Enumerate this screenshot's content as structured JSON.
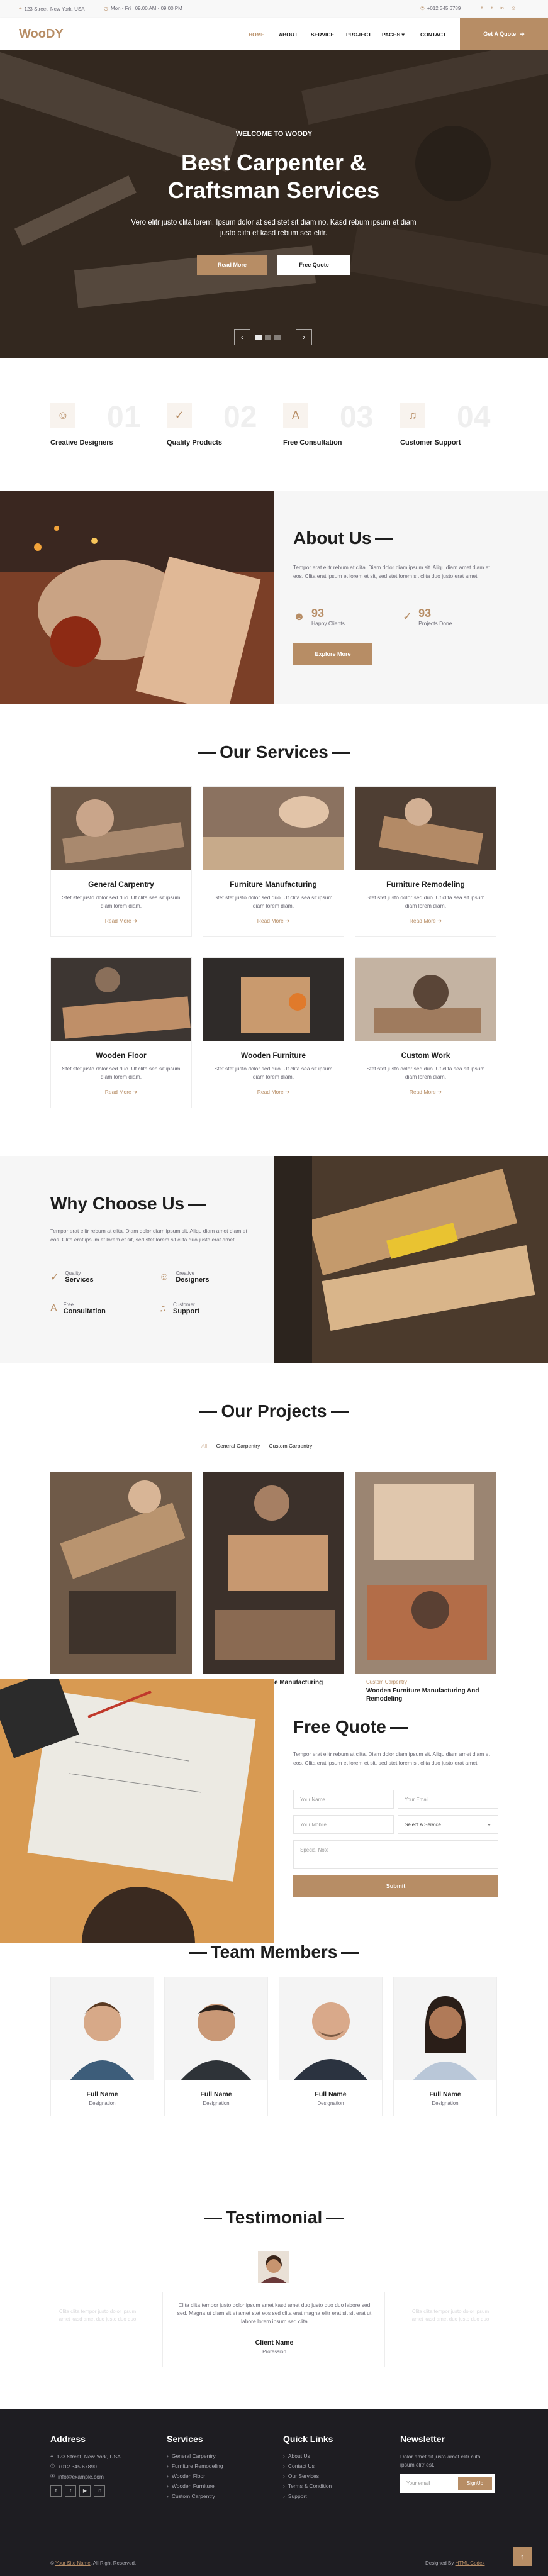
{
  "topbar": {
    "address": "123 Street, New York, USA",
    "hours": "Mon - Fri : 09.00 AM - 09.00 PM",
    "phone": "+012 345 6789"
  },
  "nav": {
    "brand": "WooDY",
    "items": [
      "HOME",
      "ABOUT",
      "SERVICE",
      "PROJECT",
      "PAGES",
      "CONTACT"
    ],
    "quote": "Get A Quote",
    "colors": {
      "accent": "#B78D65",
      "dark": "#1e1e1e"
    }
  },
  "hero": {
    "small": "WELCOME TO WOODY",
    "title": "Best Carpenter & Craftsman Services",
    "subtitle": "Vero elitr justo clita lorem. Ipsum dolor at sed stet sit diam no. Kasd rebum ipsum et diam justo clita et kasd rebum sea elitr.",
    "read_more": "Read More",
    "free_quote": "Free Quote",
    "prev": "‹",
    "next": "›"
  },
  "features": [
    {
      "num": "01",
      "label": "Creative Designers",
      "icon": "designer-icon"
    },
    {
      "num": "02",
      "label": "Quality Products",
      "icon": "check-icon"
    },
    {
      "num": "03",
      "label": "Free Consultation",
      "icon": "drafting-compass-icon"
    },
    {
      "num": "04",
      "label": "Customer Support",
      "icon": "headphones-icon"
    }
  ],
  "about": {
    "title": "About Us",
    "text": "Tempor erat elitr rebum at clita. Diam dolor diam ipsum sit. Aliqu diam amet diam et eos. Clita erat ipsum et lorem et sit, sed stet lorem sit clita duo justo erat amet",
    "stat1_num": "93",
    "stat1_label": "Happy Clients",
    "stat2_num": "93",
    "stat2_label": "Projects Done",
    "button": "Explore More"
  },
  "services": {
    "title": "Our Services",
    "desc": "Stet stet justo dolor sed duo. Ut clita sea sit ipsum diam lorem diam.",
    "read_more": "Read More",
    "items": [
      "General Carpentry",
      "Furniture Manufacturing",
      "Furniture Remodeling",
      "Wooden Floor",
      "Wooden Furniture",
      "Custom Work"
    ]
  },
  "why": {
    "title": "Why Choose Us",
    "text": "Tempor erat elitr rebum at clita. Diam dolor diam ipsum sit. Aliqu diam amet diam et eos. Clita erat ipsum et lorem et sit, sed stet lorem sit clita duo justo erat amet",
    "items": [
      {
        "top": "Quality",
        "bottom": "Services"
      },
      {
        "top": "Creative",
        "bottom": "Designers"
      },
      {
        "top": "Free",
        "bottom": "Consultation"
      },
      {
        "top": "Customer",
        "bottom": "Support"
      }
    ]
  },
  "projects": {
    "title": "Our Projects",
    "filters": [
      "All",
      "General Carpentry",
      "Custom Carpentry"
    ]
  },
  "quote": {
    "title": "Free Quote",
    "text": "Tempor erat elitr rebum at clita. Diam dolor diam ipsum sit. Aliqu diam amet diam et eos. Clita erat ipsum et lorem et sit, sed stet lorem sit clita duo justo erat amet",
    "name_ph": "Your Name",
    "email_ph": "Your Email",
    "mobile_ph": "Your Mobile",
    "service_ph": "Select A Service",
    "note_ph": "Special Note",
    "submit": "Submit",
    "overlay_left": "e Manufacturing",
    "overlay_tag": "Custom Carpentry",
    "overlay_title": "Wooden Furniture Manufacturing And Remodeling"
  },
  "team": {
    "title": "Team Members",
    "members": [
      {
        "name": "Full Name",
        "role": "Designation"
      },
      {
        "name": "Full Name",
        "role": "Designation"
      },
      {
        "name": "Full Name",
        "role": "Designation"
      },
      {
        "name": "Full Name",
        "role": "Designation"
      }
    ]
  },
  "testimonial": {
    "title": "Testimonial",
    "text": "Clita clita tempor justo dolor ipsum amet kasd amet duo justo duo duo labore sed sed. Magna ut diam sit et amet stet eos sed clita erat magna elitr erat sit sit erat ut labore lorem ipsum sed clita",
    "name": "Client Name",
    "role": "Profession",
    "side_text": "Clita clita tempor justo dolor ipsum amet kasd amet duo justo duo duo"
  },
  "footer": {
    "address_title": "Address",
    "address": "123 Street, New York, USA",
    "phone": "+012 345 67890",
    "email": "info@example.com",
    "services_title": "Services",
    "services": [
      "General Carpentry",
      "Furniture Remodeling",
      "Wooden Floor",
      "Wooden Furniture",
      "Custom Carpentry"
    ],
    "links_title": "Quick Links",
    "links": [
      "About Us",
      "Contact Us",
      "Our Services",
      "Terms & Condition",
      "Support"
    ],
    "news_title": "Newsletter",
    "news_text": "Dolor amet sit justo amet elitr clita ipsum elitr est.",
    "news_ph": "Your email",
    "signup": "SignUp",
    "copy_site": "Your Site Name",
    "copy_rest": ", All Right Reserved.",
    "designed": "Designed By",
    "designer": "HTML Codex"
  }
}
